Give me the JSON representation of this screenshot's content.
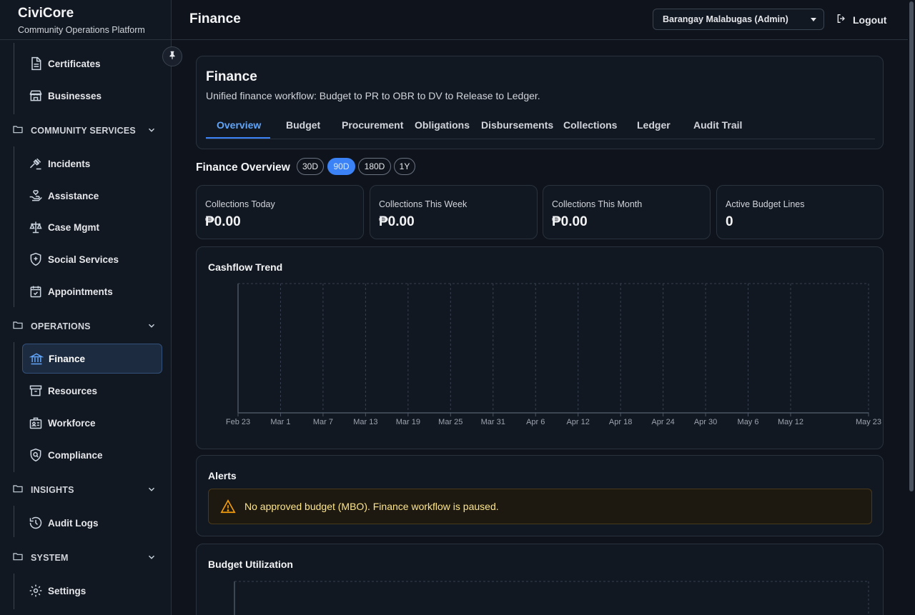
{
  "brand": {
    "name": "CiviCore",
    "subtitle": "Community Operations Platform"
  },
  "topbar": {
    "title": "Finance",
    "org_selector": "Barangay Malabugas (Admin)",
    "logout_label": "Logout"
  },
  "sidebar": {
    "items_top": [
      {
        "label": "Certificates",
        "icon": "document-icon"
      },
      {
        "label": "Businesses",
        "icon": "store-icon"
      }
    ],
    "sections": [
      {
        "label": "COMMUNITY SERVICES",
        "items": [
          {
            "label": "Incidents",
            "icon": "gavel-icon"
          },
          {
            "label": "Assistance",
            "icon": "hand-heart-icon"
          },
          {
            "label": "Case Mgmt",
            "icon": "scale-icon"
          },
          {
            "label": "Social Services",
            "icon": "shield-plus-icon"
          },
          {
            "label": "Appointments",
            "icon": "calendar-check-icon"
          }
        ]
      },
      {
        "label": "OPERATIONS",
        "items": [
          {
            "label": "Finance",
            "icon": "bank-icon",
            "active": true
          },
          {
            "label": "Resources",
            "icon": "archive-icon"
          },
          {
            "label": "Workforce",
            "icon": "id-badge-icon"
          },
          {
            "label": "Compliance",
            "icon": "shield-search-icon"
          }
        ]
      },
      {
        "label": "INSIGHTS",
        "items": [
          {
            "label": "Audit Logs",
            "icon": "history-icon"
          }
        ]
      },
      {
        "label": "SYSTEM",
        "items": [
          {
            "label": "Settings",
            "icon": "gear-icon"
          }
        ]
      }
    ]
  },
  "page": {
    "title": "Finance",
    "subtitle": "Unified finance workflow: Budget to PR to OBR to DV to Release to Ledger.",
    "tabs": [
      "Overview",
      "Budget",
      "Procurement",
      "Obligations",
      "Disbursements",
      "Collections",
      "Ledger",
      "Audit Trail"
    ],
    "active_tab": "Overview"
  },
  "overview": {
    "title": "Finance Overview",
    "ranges": [
      "30D",
      "90D",
      "180D",
      "1Y"
    ],
    "active_range": "90D",
    "stats": [
      {
        "label": "Collections Today",
        "value": "₱0.00"
      },
      {
        "label": "Collections This Week",
        "value": "₱0.00"
      },
      {
        "label": "Collections This Month",
        "value": "₱0.00"
      },
      {
        "label": "Active Budget Lines",
        "value": "0"
      }
    ]
  },
  "cashflow": {
    "title": "Cashflow Trend"
  },
  "chart_data": {
    "type": "line",
    "title": "Cashflow Trend",
    "x": [
      "Feb 23",
      "Mar 1",
      "Mar 7",
      "Mar 13",
      "Mar 19",
      "Mar 25",
      "Mar 31",
      "Apr 6",
      "Apr 12",
      "Apr 18",
      "Apr 24",
      "Apr 30",
      "May 6",
      "May 12",
      "May 23"
    ],
    "series": [],
    "grid": true
  },
  "alerts": {
    "title": "Alerts",
    "items": [
      {
        "icon": "warning-icon",
        "text": "No approved budget (MBO). Finance workflow is paused."
      }
    ]
  },
  "budget": {
    "title": "Budget Utilization"
  },
  "colors": {
    "accent": "#3b82f6",
    "warning": "#f59e0b",
    "background": "#0f141c",
    "surface": "#121821"
  }
}
